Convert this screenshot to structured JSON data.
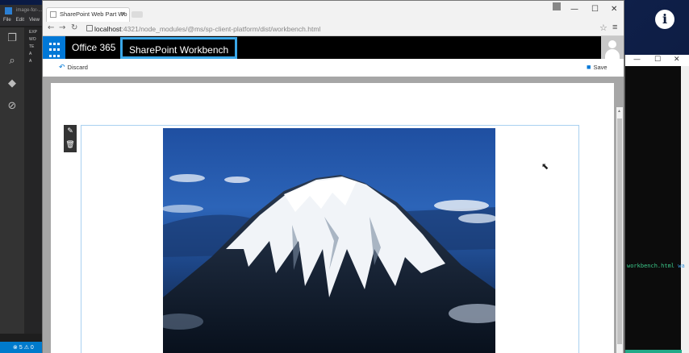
{
  "vscode": {
    "title": "image-for-...",
    "menu": [
      "File",
      "Edit",
      "View"
    ],
    "sidebar_rows": [
      "EXP",
      "WO",
      "TE",
      "A",
      "A"
    ],
    "status_errors": "5",
    "status_warnings": "0"
  },
  "terminal": {
    "text_file": "workbench.html",
    "text_suffix": "wa"
  },
  "browser": {
    "tab_title": "SharePoint Web Part Wo",
    "url_host": "localhost",
    "url_rest": ":4321/node_modules/@ms/sp-client-platform/dist/workbench.html"
  },
  "suitebar": {
    "brand": "Office 365",
    "site_title": "SharePoint Workbench"
  },
  "commands": {
    "discard": "Discard",
    "save": "Save"
  },
  "colors": {
    "suite_accent": "#0078d7",
    "highlight": "#3aa7e8"
  },
  "icons": {
    "waffle": "app-launcher-icon",
    "edit": "pencil-icon",
    "delete": "trash-icon"
  }
}
